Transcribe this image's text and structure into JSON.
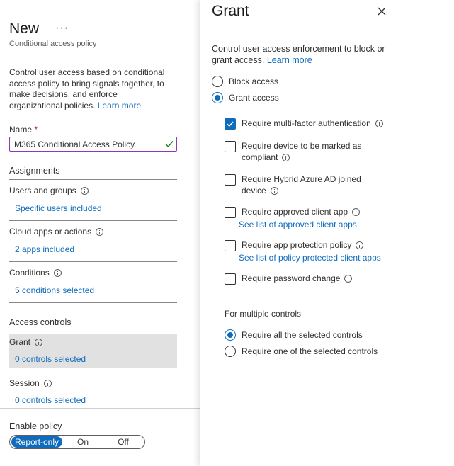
{
  "left": {
    "title": "New",
    "more_label": "···",
    "subtitle": "Conditional access policy",
    "description": "Control user access based on conditional access policy to bring signals together, to make decisions, and enforce organizational policies.",
    "learn_more": "Learn more",
    "name_label": "Name",
    "name_required": "*",
    "name_value": "M365 Conditional Access Policy",
    "assignments_heading": "Assignments",
    "users_label": "Users and groups",
    "users_value": "Specific users included",
    "cloud_label": "Cloud apps or actions",
    "cloud_value": "2 apps included",
    "conditions_label": "Conditions",
    "conditions_value": "5 conditions selected",
    "access_heading": "Access controls",
    "grant_label": "Grant",
    "grant_value": "0 controls selected",
    "session_label": "Session",
    "session_value": "0 controls selected",
    "enable_label": "Enable policy",
    "toggle": {
      "report_only": "Report-only",
      "on": "On",
      "off": "Off",
      "selected": "Report-only"
    }
  },
  "grant": {
    "title": "Grant",
    "description": "Control user access enforcement to block or grant access.",
    "learn_more": "Learn more",
    "block_access": "Block access",
    "grant_access": "Grant access",
    "selected_access": "Grant access",
    "controls": [
      {
        "label": "Require multi-factor authentication",
        "checked": true
      },
      {
        "label": "Require device to be marked as compliant",
        "checked": false
      },
      {
        "label": "Require Hybrid Azure AD joined device",
        "checked": false
      },
      {
        "label": "Require approved client app",
        "checked": false,
        "link": "See list of approved client apps"
      },
      {
        "label": "Require app protection policy",
        "checked": false,
        "link": "See list of policy protected client apps"
      },
      {
        "label": "Require password change",
        "checked": false
      }
    ],
    "multiple_label": "For multiple controls",
    "require_all": "Require all the selected controls",
    "require_one": "Require one of the selected controls",
    "multiple_selected": "Require all the selected controls"
  },
  "colors": {
    "accent": "#0f6cbd",
    "valid": "#107c10",
    "focus_border": "#8a3ab9",
    "selected_row": "#e1e1e1"
  }
}
